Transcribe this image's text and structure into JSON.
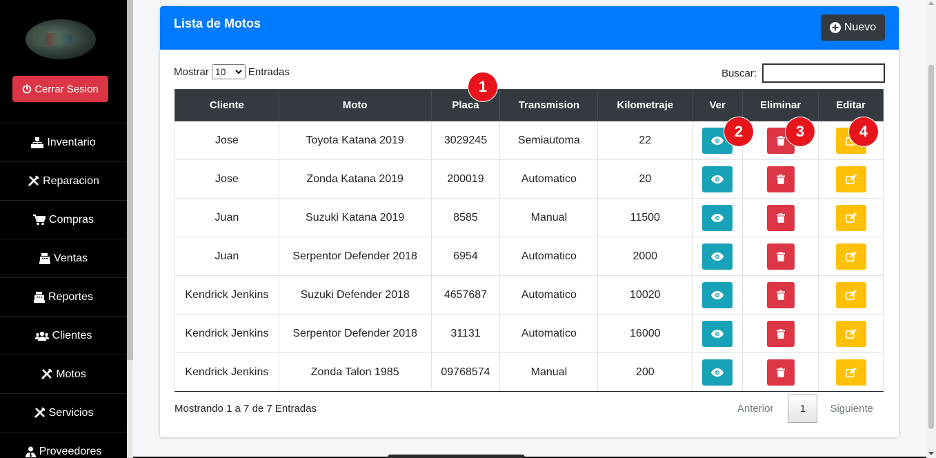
{
  "sidebar": {
    "logout_label": "Cerrar Sesion",
    "items": [
      {
        "label": "Inventario",
        "icon": "sitemap-icon"
      },
      {
        "label": "Reparacion",
        "icon": "tools-icon"
      },
      {
        "label": "Compras",
        "icon": "cart-icon"
      },
      {
        "label": "Ventas",
        "icon": "cash-register-icon"
      },
      {
        "label": "Reportes",
        "icon": "cash-register-icon"
      },
      {
        "label": "Clientes",
        "icon": "users-icon"
      },
      {
        "label": "Motos",
        "icon": "tools-icon"
      },
      {
        "label": "Servicios",
        "icon": "tools-icon"
      },
      {
        "label": "Proveedores",
        "icon": "user-tie-icon"
      }
    ]
  },
  "card": {
    "title": "Lista de Motos",
    "new_label": "Nuevo",
    "show_label": "Mostrar",
    "show_value": "10",
    "entries_label": "Entradas",
    "search_label": "Buscar:",
    "search_value": ""
  },
  "table": {
    "columns": [
      "Cliente",
      "Moto",
      "Placa",
      "Transmision",
      "Kilometraje",
      "Ver",
      "Eliminar",
      "Editar"
    ],
    "rows": [
      [
        "Jose",
        "Toyota Katana 2019",
        "3029245",
        "Semiautoma",
        "22"
      ],
      [
        "Jose",
        "Zonda Katana 2019",
        "200019",
        "Automatico",
        "20"
      ],
      [
        "Juan",
        "Suzuki Katana 2019",
        "8585",
        "Manual",
        "11500"
      ],
      [
        "Juan",
        "Serpentor Defender 2018",
        "6954",
        "Automatico",
        "2000"
      ],
      [
        "Kendrick Jenkins",
        "Suzuki Defender 2018",
        "4657687",
        "Automatico",
        "10020"
      ],
      [
        "Kendrick Jenkins",
        "Serpentor Defender 2018",
        "31131",
        "Automatico",
        "16000"
      ],
      [
        "Kendrick Jenkins",
        "Zonda Talon 1985",
        "09768574",
        "Manual",
        "200"
      ]
    ]
  },
  "footer": {
    "info": "Mostrando 1 a 7 de 7 Entradas",
    "prev": "Anterior",
    "page": "1",
    "next": "Siguiente"
  },
  "annotations": [
    "1",
    "2",
    "3",
    "4"
  ],
  "colors": {
    "primary": "#007bff",
    "dark": "#343a40",
    "info": "#17a2b8",
    "danger": "#dc3545",
    "warning": "#ffc107",
    "badge": "#e8141b"
  }
}
